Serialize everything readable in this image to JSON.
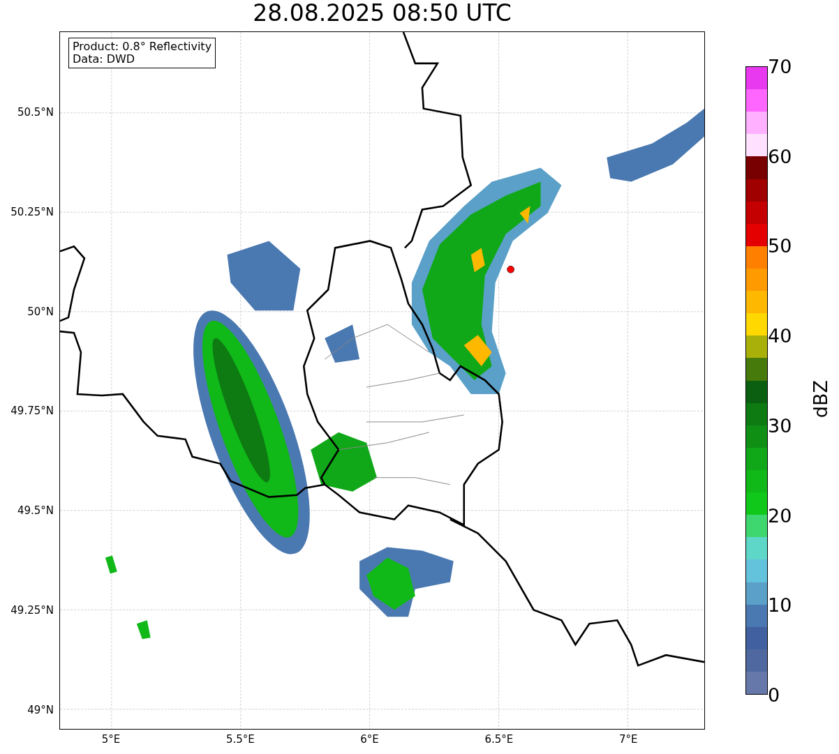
{
  "title": "28.08.2025 08:50 UTC",
  "info_box": {
    "lines": [
      "Product: 0.8° Reflectivity",
      "Data: DWD"
    ]
  },
  "y_ticks": [
    "50.5°N",
    "50.25°N",
    "50°N",
    "49.75°N",
    "49.5°N",
    "49.25°N",
    "49°N"
  ],
  "x_ticks": [
    "5°E",
    "5.5°E",
    "6°E",
    "6.5°E",
    "7°E"
  ],
  "colorbar": {
    "label": "dBZ",
    "ticks": [
      "70",
      "60",
      "50",
      "40",
      "30",
      "20",
      "10",
      "0"
    ],
    "segments": [
      {
        "color": "#e838f0"
      },
      {
        "color": "#ff66ff"
      },
      {
        "color": "#ffb0ff"
      },
      {
        "color": "#ffe0ff"
      },
      {
        "color": "#780000"
      },
      {
        "color": "#a00000"
      },
      {
        "color": "#c40000"
      },
      {
        "color": "#e40000"
      },
      {
        "color": "#ff7f00"
      },
      {
        "color": "#ff9a00"
      },
      {
        "color": "#ffb800"
      },
      {
        "color": "#ffd800"
      },
      {
        "color": "#aab00a"
      },
      {
        "color": "#467a0a"
      },
      {
        "color": "#0a6010"
      },
      {
        "color": "#0d7a12"
      },
      {
        "color": "#0f9015"
      },
      {
        "color": "#10a818"
      },
      {
        "color": "#10b818"
      },
      {
        "color": "#10c81a"
      },
      {
        "color": "#3ed66e"
      },
      {
        "color": "#5ed6c8"
      },
      {
        "color": "#63c2dc"
      },
      {
        "color": "#5aa0c8"
      },
      {
        "color": "#4a78b0"
      },
      {
        "color": "#4060a0"
      },
      {
        "color": "#5068a0"
      },
      {
        "color": "#6677aa"
      }
    ]
  }
}
